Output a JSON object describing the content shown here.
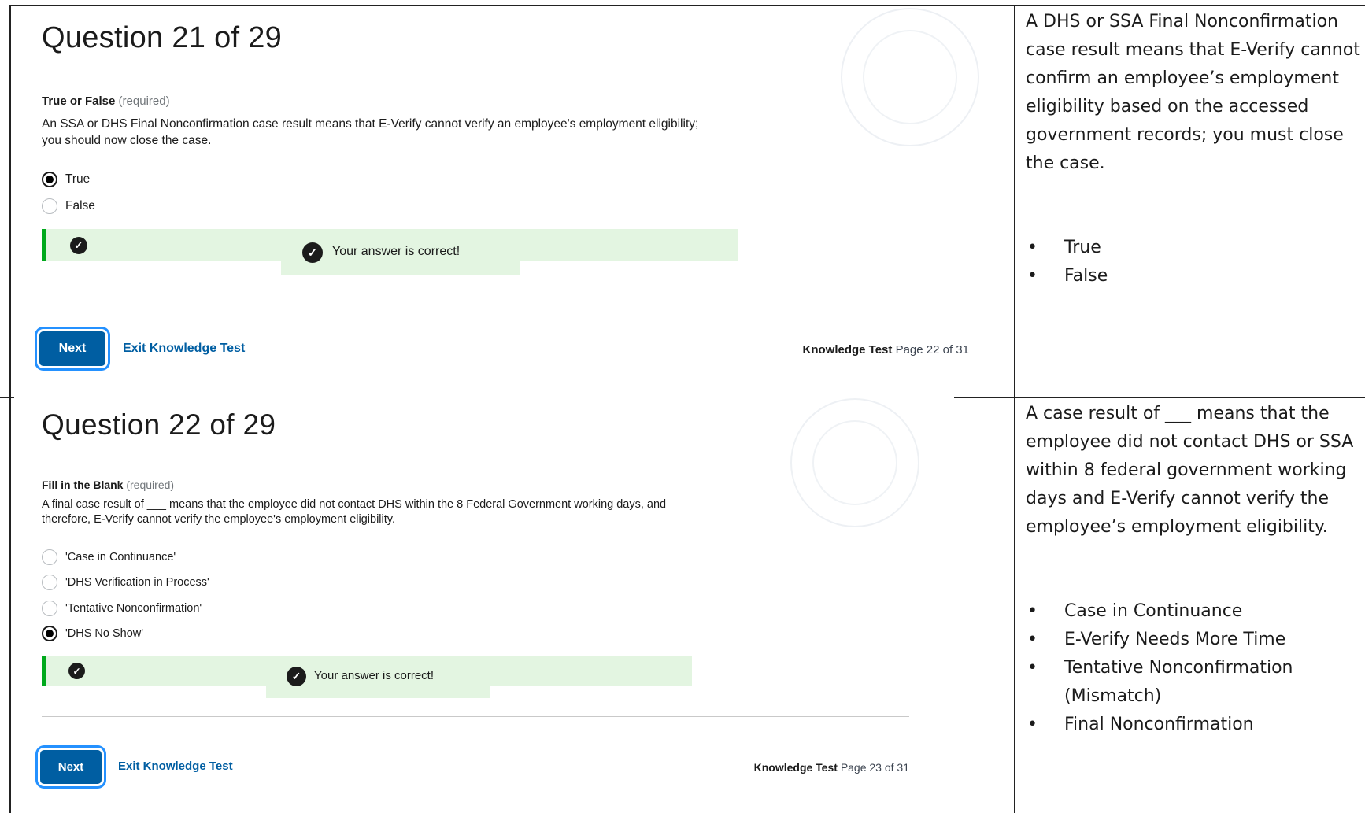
{
  "q1": {
    "title": "Question 21 of 29",
    "type_label": "True or False",
    "required_label": "(required)",
    "question_text": "An SSA or DHS Final Nonconfirmation case result means that E-Verify cannot verify an employee's employment eligibility; you should now close the case.",
    "options": [
      {
        "label": "True",
        "selected": true
      },
      {
        "label": "False",
        "selected": false
      }
    ],
    "feedback": "Your answer is correct!",
    "next_label": "Next",
    "exit_label": "Exit Knowledge Test",
    "page_label": "Knowledge Test",
    "page_number": "Page 22 of 31",
    "side_text": "A DHS or SSA Final Nonconfirmation case result means that E-Verify cannot confirm an employee’s employment eligibility based on the accessed government records; you must close the case.",
    "side_options": [
      "True",
      "False"
    ]
  },
  "q2": {
    "title": "Question 22 of 29",
    "type_label": "Fill in the Blank",
    "required_label": "(required)",
    "question_text": "A final case result of ___ means that the employee did not contact DHS within the 8 Federal Government working days, and therefore, E-Verify cannot verify the employee's employment eligibility.",
    "options": [
      {
        "label": "'Case in Continuance'",
        "selected": false
      },
      {
        "label": "'DHS Verification in Process'",
        "selected": false
      },
      {
        "label": "'Tentative Nonconfirmation'",
        "selected": false
      },
      {
        "label": "'DHS No Show'",
        "selected": true
      }
    ],
    "feedback": "Your answer is correct!",
    "next_label": "Next",
    "exit_label": "Exit Knowledge Test",
    "page_label": "Knowledge Test",
    "page_number": "Page 23 of 31",
    "side_text": "A case result of ___ means that the employee did not contact DHS or SSA within 8 federal government working days and E-Verify cannot verify the employee’s employment eligibility.",
    "side_options": [
      "Case in Continuance",
      "E-Verify Needs More Time",
      "Tentative Nonconfirmation (Mismatch)",
      "Final Nonconfirmation"
    ]
  },
  "colors": {
    "primary": "#005ea2",
    "success_bg": "#e3f5e1",
    "success_bar": "#00a91c",
    "focus_ring": "#2491ff"
  },
  "icons": [
    "check-circle-icon",
    "dhs-seal-watermark"
  ]
}
